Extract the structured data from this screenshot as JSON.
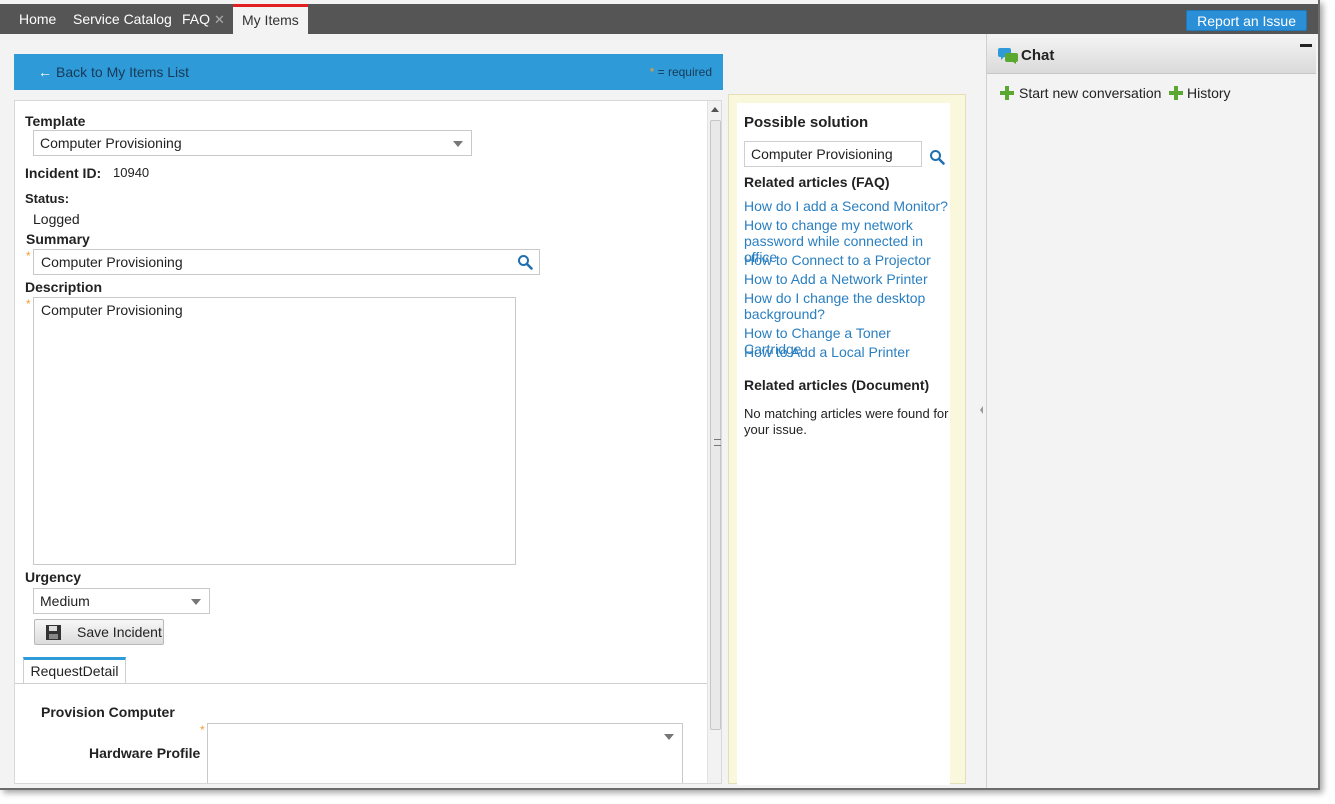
{
  "nav": {
    "tabs": [
      {
        "label": "Home"
      },
      {
        "label": "Service Catalog"
      },
      {
        "label": "FAQ"
      },
      {
        "label": "My Items"
      }
    ],
    "close_glyph": "✕",
    "report_button": "Report an Issue"
  },
  "backbar": {
    "back_label": "Back to My Items List",
    "required_star": "*",
    "required_text": "= required"
  },
  "form": {
    "template_label": "Template",
    "template_value": "Computer Provisioning",
    "incident_id_label": "Incident ID:",
    "incident_id_value": "10940",
    "status_label": "Status:",
    "status_value": "Logged",
    "summary_label": "Summary",
    "summary_value": "Computer Provisioning",
    "description_label": "Description",
    "description_value": "Computer Provisioning",
    "urgency_label": "Urgency",
    "urgency_value": "Medium",
    "save_label": "Save Incident",
    "request_tab_label": "RequestDetail",
    "provision_heading": "Provision Computer",
    "hardware_profile_label": "Hardware Profile",
    "required_star": "*"
  },
  "solution": {
    "title": "Possible solution",
    "search_value": "Computer Provisioning",
    "faq_heading": "Related articles (FAQ)",
    "faq_links": [
      {
        "label": "How do I add a Second Monitor?"
      },
      {
        "label": "How to change my network password while connected in office"
      },
      {
        "label": "How to Connect to a Projector"
      },
      {
        "label": "How to Add a Network Printer"
      },
      {
        "label": "How do I change the desktop background?"
      },
      {
        "label": "How to Change a Toner Cartridge"
      },
      {
        "label": "How to Add a Local Printer"
      }
    ],
    "doc_heading": "Related articles (Document)",
    "doc_empty": "No matching articles were found for your issue."
  },
  "chat": {
    "title": "Chat",
    "start_label": "Start new conversation",
    "history_label": "History"
  },
  "colors": {
    "accent_blue": "#2e9ad8",
    "link_blue": "#2a7fc0",
    "active_tab_marker": "#e02020",
    "required_star": "#f0a030",
    "add_green": "#5aa832"
  },
  "icons": [
    "arrow-left-icon",
    "search-icon",
    "chevron-down-icon",
    "save-icon",
    "chat-icon",
    "plus-icon",
    "close-icon",
    "minimize-icon"
  ]
}
